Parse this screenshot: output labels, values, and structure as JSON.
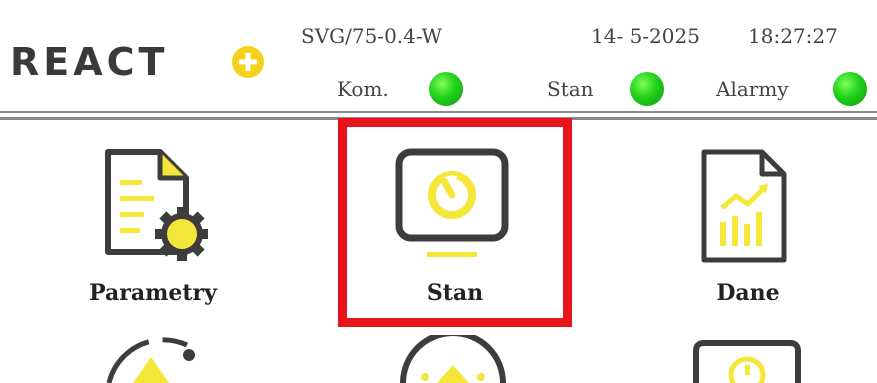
{
  "header": {
    "logo_text": "REACT",
    "device": "SVG/75-0.4-W",
    "date": "14- 5-2025",
    "time": "18:27:27",
    "indicators": [
      {
        "label": "Kom.",
        "status_color": "#22d01a"
      },
      {
        "label": "Stan",
        "status_color": "#22d01a"
      },
      {
        "label": "Alarmy",
        "status_color": "#22d01a"
      }
    ]
  },
  "menu": {
    "tiles": [
      {
        "label": "Parametry",
        "icon": "document-gear-icon",
        "selected": false
      },
      {
        "label": "Stan",
        "icon": "monitor-gauge-icon",
        "selected": true
      },
      {
        "label": "Dane",
        "icon": "document-chart-icon",
        "selected": false
      }
    ],
    "selected_color": "#e8141b",
    "accent_color": "#f5e63a"
  }
}
